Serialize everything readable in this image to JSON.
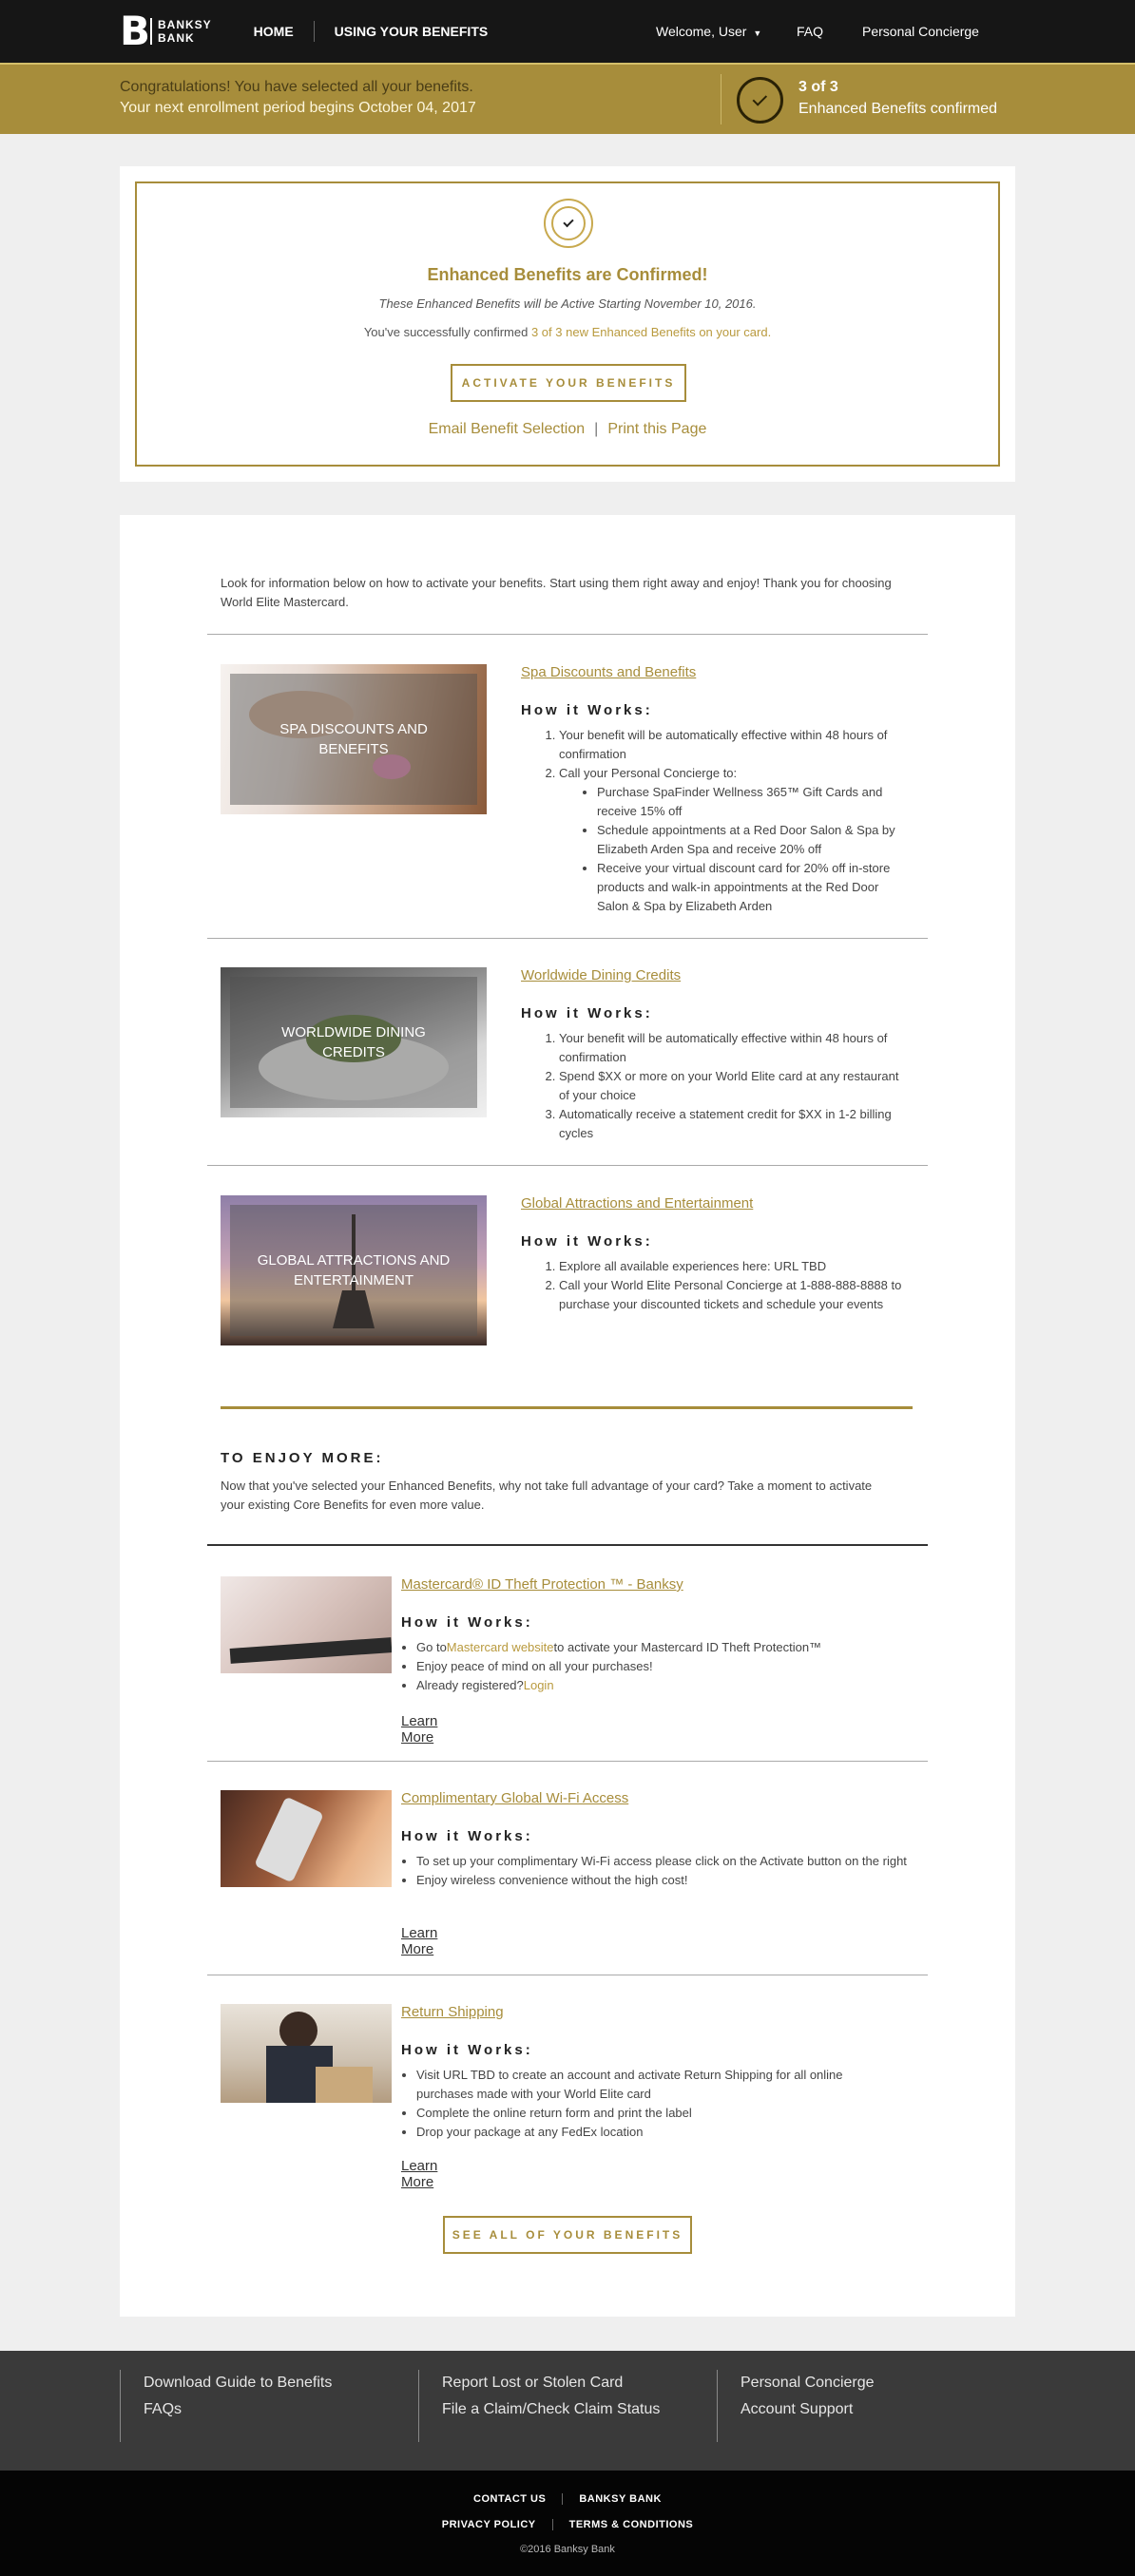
{
  "header": {
    "logo_mark": "B",
    "logo_line1": "BANKSY",
    "logo_line2": "BANK",
    "nav_home": "HOME",
    "nav_using": "USING YOUR BENEFITS",
    "welcome": "Welcome, User",
    "faq": "FAQ",
    "concierge": "Personal Concierge"
  },
  "banner": {
    "line1": "Congratulations! You have selected all your benefits.",
    "line2": "Your next enrollment period begins October 04, 2017",
    "count": "3 of 3",
    "confirmed": "Enhanced Benefits confirmed"
  },
  "confirmation": {
    "title": "Enhanced Benefits are Confirmed!",
    "subtitle": "These Enhanced Benefits will be Active Starting November 10, 2016.",
    "line_prefix": "You've successfully confirmed ",
    "line_highlight": "3 of 3 new Enhanced Benefits on your card.",
    "activate_button": "ACTIVATE YOUR BENEFITS",
    "email_link": "Email Benefit Selection",
    "link_sep": "|",
    "print_link": "Print this Page"
  },
  "intro": "Look for information below on how to activate your benefits. Start using them right away and enjoy! Thank you for choosing World Elite Mastercard.",
  "how_label": "How it Works:",
  "enhanced": [
    {
      "title": "Spa Discounts and Benefits",
      "image_caption": "SPA DISCOUNTS AND BENEFITS",
      "steps": [
        "Your benefit will be automatically effective within 48 hours of confirmation",
        "Call your Personal Concierge to:"
      ],
      "substeps": [
        "Purchase SpaFinder Wellness 365™ Gift Cards and receive 15% off",
        "Schedule appointments at a Red Door Salon & Spa by Elizabeth Arden Spa and receive 20% off",
        "Receive your virtual discount card for 20% off in-store products and walk-in appointments at the Red Door Salon & Spa by Elizabeth Arden"
      ]
    },
    {
      "title": "Worldwide Dining Credits",
      "image_caption": "WORLDWIDE DINING CREDITS",
      "steps": [
        "Your benefit will be automatically effective within 48 hours of confirmation",
        "Spend $XX or more on your World Elite card at any restaurant of your choice",
        "Automatically receive a statement credit for $XX in 1-2 billing cycles"
      ]
    },
    {
      "title": "Global Attractions and Entertainment",
      "image_caption": "GLOBAL ATTRACTIONS AND ENTERTAINMENT",
      "steps": [
        "Explore all available experiences here: URL TBD",
        "Call your World Elite Personal Concierge at 1-888-888-8888 to purchase your discounted tickets and schedule your events"
      ]
    }
  ],
  "enjoy": {
    "heading": "TO ENJOY MORE:",
    "text": "Now that you've selected your Enhanced Benefits, why not take full advantage of your card? Take a moment to activate your existing Core Benefits for even more value."
  },
  "core": [
    {
      "title": "Mastercard® ID Theft Protection ™ - Banksy",
      "b1_pre": "Go to",
      "b1_link": "Mastercard website",
      "b1_post": "to activate your Mastercard ID Theft Protection™",
      "b2": "Enjoy peace of mind on all your purchases!",
      "b3_pre": "Already registered?",
      "b3_link": "Login",
      "learn": "Learn More"
    },
    {
      "title": "Complimentary Global Wi-Fi Access",
      "bullets": [
        "To set up your complimentary Wi-Fi access please click on the Activate button on the right",
        "Enjoy wireless convenience without the high cost!"
      ],
      "learn": "Learn More"
    },
    {
      "title": "Return Shipping",
      "bullets": [
        "Visit URL TBD to create an account and activate Return Shipping for all online purchases made with your World Elite card",
        "Complete the online return form and print the label",
        "Drop your package at any FedEx location"
      ],
      "learn": "Learn More"
    }
  ],
  "see_all_button": "SEE ALL OF YOUR BENEFITS",
  "footer": {
    "col1": [
      "Download Guide to Benefits",
      "FAQs"
    ],
    "col2": [
      "Report Lost or Stolen Card",
      "File a Claim/Check Claim Status"
    ],
    "col3": [
      "Personal Concierge",
      "Account Support"
    ],
    "row1": [
      "CONTACT US",
      "BANKSY BANK"
    ],
    "row2": [
      "PRIVACY POLICY",
      "TERMS & CONDITIONS"
    ],
    "copyright": "©2016 Banksy Bank"
  },
  "colors": {
    "gold": "#a78d3b",
    "header_bg": "#161616",
    "footer_bg": "#3a3a3a"
  }
}
